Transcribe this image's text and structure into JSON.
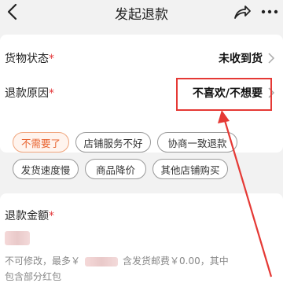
{
  "nav": {
    "title": "发起退款"
  },
  "goods_status": {
    "label": "货物状态",
    "required_mark": "*",
    "value": "未收到货"
  },
  "refund_reason": {
    "label": "退款原因",
    "required_mark": "*",
    "value": "不喜欢/不想要"
  },
  "reason_chips": [
    {
      "label": "不需要了",
      "selected": true
    },
    {
      "label": "店铺服务不好",
      "selected": false
    },
    {
      "label": "协商一致退款",
      "selected": false
    },
    {
      "label": "发货速度慢",
      "selected": false
    },
    {
      "label": "商品降价",
      "selected": false
    },
    {
      "label": "其他店铺购买",
      "selected": false
    }
  ],
  "refund_amount": {
    "label": "退款金额",
    "required_mark": "*",
    "note_line1_prefix": "不可修改，最多￥",
    "note_line1_suffix": "含发货邮费￥0.00，其中",
    "note_line2": "包含部分红包"
  },
  "colors": {
    "accent": "#e8622e",
    "required": "#e4393c",
    "annotation_arrow": "#e53935"
  },
  "icons": {
    "back": "chevron-left-icon",
    "share": "share-icon",
    "more": "more-icon",
    "row_chevron": "chevron-right-icon"
  }
}
